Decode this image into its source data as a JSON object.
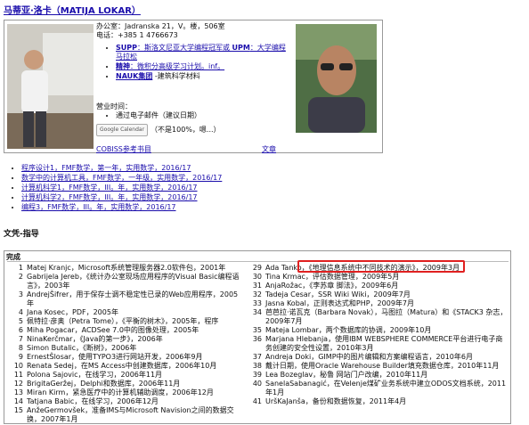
{
  "page": {
    "title": "马蒂亚·洛卡（MATIJA LOKAR）"
  },
  "profile": {
    "office_line": "办公室：Jadranska 21，V。楼，506室",
    "phone_line": "电话：+385 1 4766673",
    "affiliations": [
      {
        "prefix": "SUPP",
        "text": "：斯洛文尼亚大学编程冠军或 ",
        "link2": "UPM",
        "text2": "：大学编程马拉松"
      },
      {
        "prefix": "精神",
        "text": "：微积分高级学习计划。inf。",
        "link2": "",
        "text2": ""
      },
      {
        "prefix": "NAUK集团",
        "text": " -建筑科学材料",
        "link2": "",
        "text2": ""
      }
    ],
    "office_hours_label": "营业时间：",
    "office_hours_item": "通过电子邮件（建议日期）",
    "gcal_button": "Google Calendar",
    "gcal_note": "（不是100%，嗯...）",
    "cobiss_link": "COBISS参考书目",
    "works_link": "文章"
  },
  "courses": [
    "程序设计1，FMF数学，第一年，实用数学，2016/17",
    "数学中的计算机工具，FMF数学，一年级，实用数学，2016/17",
    "计算机科学1，FMF数学，III。年，实用数学，2016/17",
    "计算机科学2，FMF数学，III。年，实用数学，2016/17",
    "编程3，FMF数学，III。年，实用数学，2016/17"
  ],
  "theses": {
    "section_title": "文凭-指导",
    "head": "完成",
    "left": [
      {
        "n": "1",
        "t": "Matej Kranjc，Microsoft系统管理服务器2.0软件包，2001年"
      },
      {
        "n": "2",
        "t": "Gabrijela Jereb，《统计办公室现场应用程序的Visual Basic编程语言》，2003年"
      },
      {
        "n": "3",
        "t": "AndrejŠifrer，用于保存士调不稳定性已录的Web应用程序，2005年"
      },
      {
        "n": "4",
        "t": "Jana Kosec，PDF，2005年"
      },
      {
        "n": "5",
        "t": "佩特拉·彦奥（Petra Tome），《平衡的树木》，2005年，程序"
      },
      {
        "n": "6",
        "t": "Miha Pogacar，ACDSee 7.0中的图像处理，2005年"
      },
      {
        "n": "7",
        "t": "NinaKerčmar，《Java的第一步》，2006年"
      },
      {
        "n": "8",
        "t": "Simon Butalic，《断树》，2006年"
      },
      {
        "n": "9",
        "t": "ErnestŠlosar，使用TYPO3进行网站开发，2006年9月"
      },
      {
        "n": "10",
        "t": "Renata Sedej，在MS Access中创建数据库，2006年10月"
      },
      {
        "n": "11",
        "t": "Polona Sajovic，在线学习，2006年11月"
      },
      {
        "n": "12",
        "t": "BrigitaGeržej，Delphi和数据库，2006年11月"
      },
      {
        "n": "13",
        "t": "Miran Kirm，紧急医疗中的计算机辅助调度，2006年12月"
      },
      {
        "n": "14",
        "t": "Tatjana Babic，在线学习，2006年12月"
      },
      {
        "n": "15",
        "t": "AnžeGermovšek，准备IMS与Microsoft Navision之间的数据交换，2007年1月"
      }
    ],
    "right": [
      {
        "n": "29",
        "t": "Ada Tanko，《地理信息系统中不同技术的演示》，2009年3月"
      },
      {
        "n": "30",
        "t": "Tina Krmac，评估数据管理，2009年5月"
      },
      {
        "n": "31",
        "t": "AnjaRožac，《李苏章 脚法》，2009年6月"
      },
      {
        "n": "32",
        "t": "Tadeja Cesar，SSR Wiki Wiki，2009年7月"
      },
      {
        "n": "33",
        "t": "Jasna Kobal，正则表达式和PHP，2009年7月"
      },
      {
        "n": "34",
        "t": "芭芭拉·诺瓦克（Barbara Novak），马图拉（Matura）和《STACK3 杂志，2009年7月"
      },
      {
        "n": "35",
        "t": "Mateja Lombar，两个数据库的协调，2009年10月"
      },
      {
        "n": "36",
        "t": "Marjana Hlebanja，使用IBM WEBSPHERE COMMERCE平台进行电子商务创建的安全性设置，2010年3月"
      },
      {
        "n": "37",
        "t": "Andreja Doki，GIMP中的图片编辑和方案编程语言，2010年6月"
      },
      {
        "n": "38",
        "t": "戴计日期，使用Oracle Warehouse Builder填充数据仓库，2010年11月"
      },
      {
        "n": "39",
        "t": "Lea Bozeglav，秘鲁 网站门户改编，2010年11月"
      },
      {
        "n": "40",
        "t": "SanelaSabanagić，在Velenje煤矿业务系统中建立ODOS文档系统，2011年1月"
      },
      {
        "n": "41",
        "t": "UršKaJanša，备份和数据恢复，2011年4月"
      }
    ]
  },
  "colors": {
    "link": "#1a0dab",
    "highlight": "#e02020",
    "border": "#999999"
  }
}
